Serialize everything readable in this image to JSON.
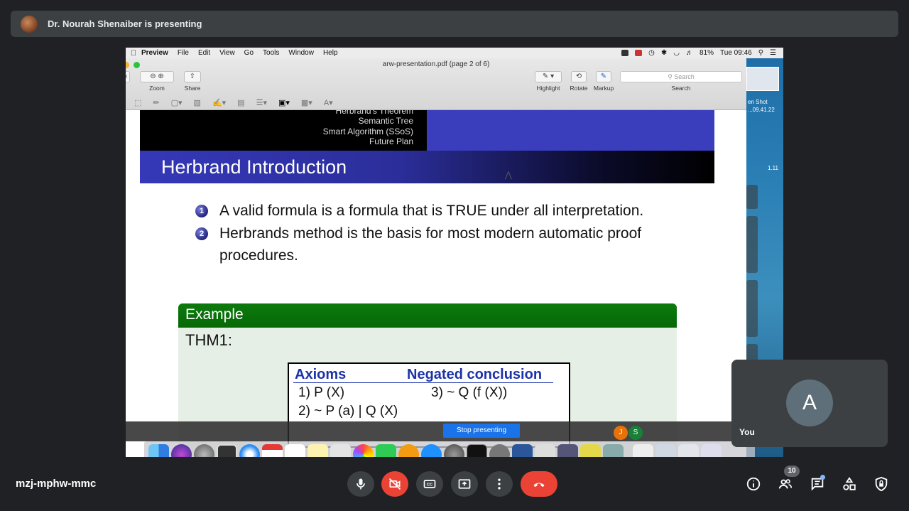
{
  "banner": {
    "presenter_text": "Dr. Nourah Shenaiber is presenting"
  },
  "mac_menubar": {
    "app": "Preview",
    "items": [
      "File",
      "Edit",
      "View",
      "Go",
      "Tools",
      "Window",
      "Help"
    ],
    "battery": "81%",
    "clock": "Tue 09:46"
  },
  "preview": {
    "doc_title": "arw-presentation.pdf (page 2 of 6)",
    "toolbar": {
      "zoom_label": "Zoom",
      "share_label": "Share",
      "highlight_label": "Highlight",
      "rotate_label": "Rotate",
      "markup_label": "Markup",
      "search_label": "Search",
      "search_placeholder": "Search"
    }
  },
  "slide": {
    "nav_items": [
      "Herbrand's Theorem",
      "Semantic Tree",
      "Smart Algorithm (SSoS)",
      "Future Plan"
    ],
    "title": "Herbrand Introduction",
    "bullets": [
      {
        "num": "1",
        "text": "A valid formula is a formula that is TRUE under all interpretation."
      },
      {
        "num": "2",
        "text": "Herbrands method is the basis for most modern automatic proof procedures."
      }
    ],
    "example_title": "Example",
    "example_sub": "THM1:",
    "axioms_header": "Axioms",
    "negated_header": "Negated conclusion",
    "axiom_1": "1) P (X)",
    "axiom_2": "2) ~ P (a) | Q (X)",
    "negated_3": "3) ~ Q (f (X))"
  },
  "share_overlay": {
    "stop_label": "Stop presenting",
    "avatars": [
      "J",
      "S"
    ]
  },
  "desktop": {
    "file_label_1": "en Shot",
    "file_label_2": "...09.41.22",
    "file_label_3": "1.11"
  },
  "self_tile": {
    "avatar_letter": "A",
    "name": "You"
  },
  "meeting": {
    "code": "mzj-mphw-mmc",
    "participant_count": "10"
  },
  "colors": {
    "hangup": "#ea4335",
    "stop_presenting": "#1a73e8",
    "slide_title_bar": "#3538b8",
    "example_header": "#0d7a0d"
  }
}
